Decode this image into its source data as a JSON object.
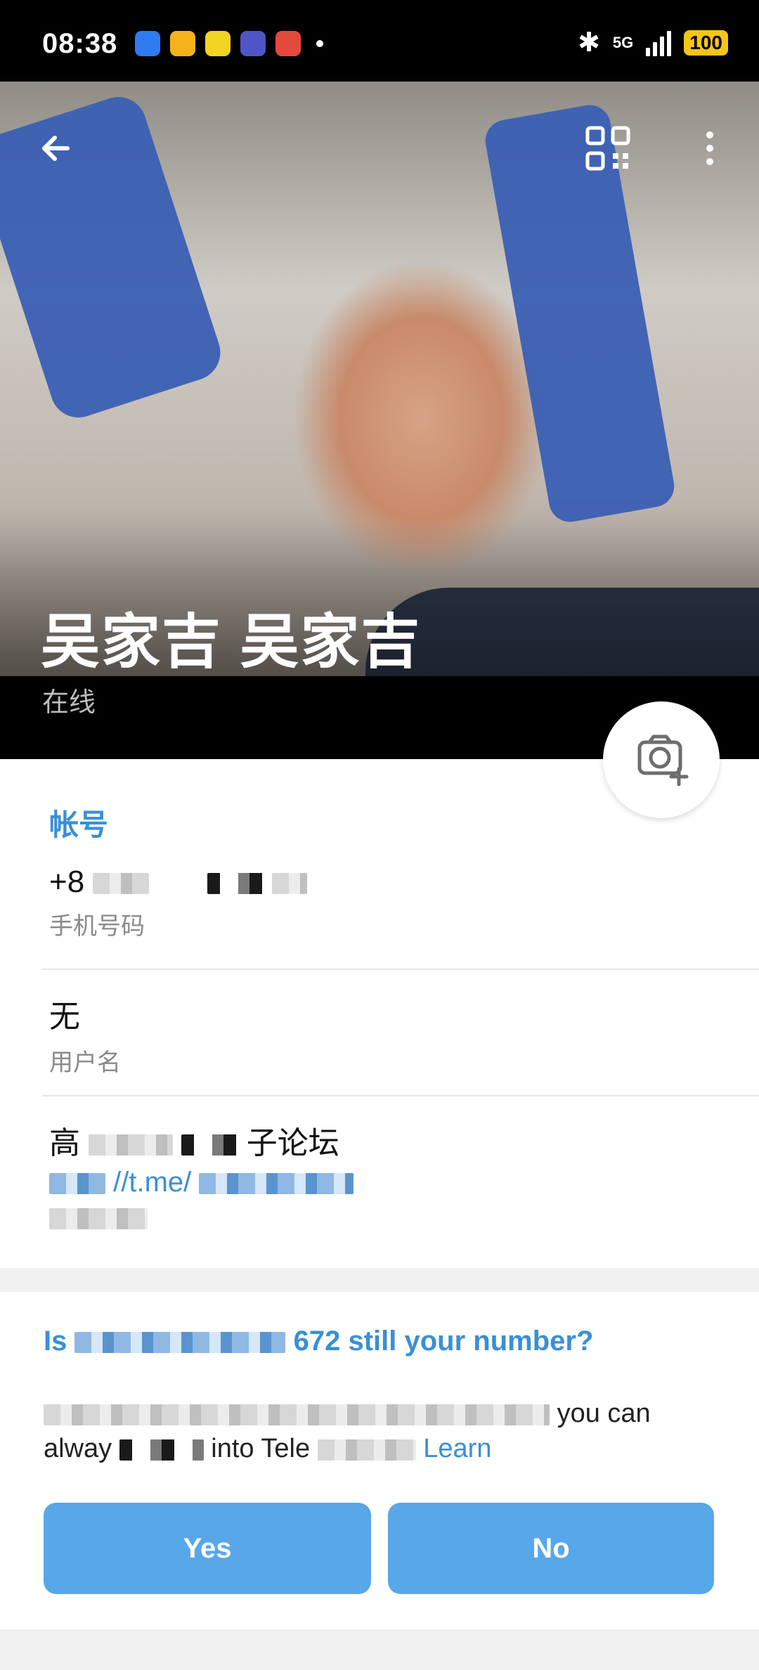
{
  "status_bar": {
    "time": "08:38",
    "network": "5G",
    "battery": "100",
    "colors": {
      "battery": "#f5c518"
    }
  },
  "header": {
    "back_icon": "back-arrow-icon",
    "qr_icon": "qr-code-icon",
    "more_icon": "more-vert-icon"
  },
  "profile": {
    "name": "吴家吉 吴家吉",
    "status": "在线"
  },
  "account_section": {
    "title": "帐号",
    "phone": {
      "value": "+8",
      "label": "手机号码"
    },
    "username": {
      "value": "无",
      "label": "用户名"
    },
    "bio": {
      "line1_start": "高",
      "line1_end": "子论坛",
      "link_visible": "//t.me/"
    }
  },
  "verify_prompt": {
    "title_start": "Is",
    "title_mid": "672 still your number?",
    "body_end": "you can",
    "body_line2": "alway",
    "body_line2b": "into Tele",
    "learn": "Learn",
    "yes_label": "Yes",
    "no_label": "No"
  },
  "colors": {
    "accent": "#3a8fd6",
    "button": "#57a7e9",
    "headset": "#3b5fb4"
  }
}
